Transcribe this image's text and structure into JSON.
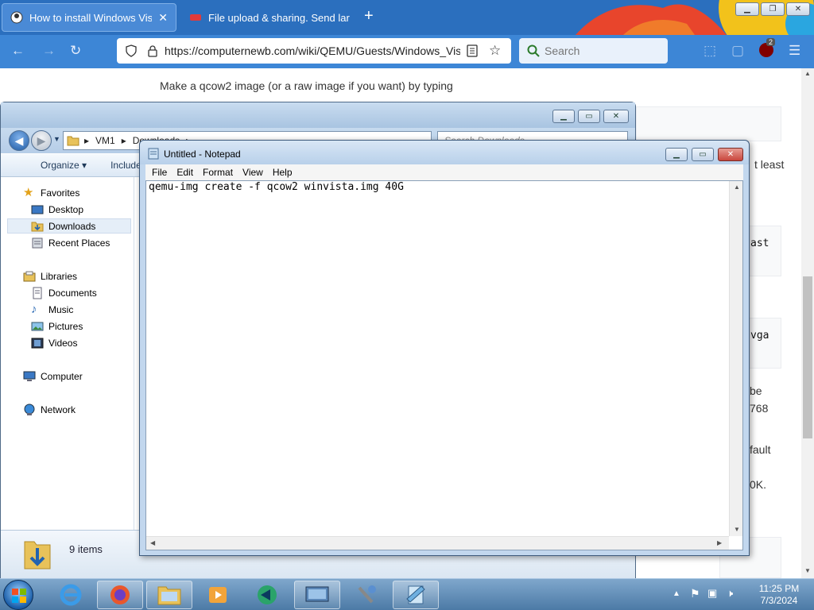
{
  "browser": {
    "tabs": [
      {
        "title": "How to install Windows Vista",
        "active": true
      },
      {
        "title": "File upload & sharing. Send lar",
        "active": false
      }
    ],
    "url": "https://computernewb.com/wiki/QEMU/Guests/Windows_Vis",
    "search_placeholder": "Search",
    "extension_badge": "2"
  },
  "webpage": {
    "intro_text": "Make a qcow2 image (or a raw image if you want) by typing",
    "right_fragments": [
      "t least",
      "ast",
      "vga",
      "be",
      "768",
      "fault",
      "0K."
    ]
  },
  "explorer": {
    "breadcrumb": [
      "VM1",
      "Downloads"
    ],
    "search_placeholder": "Search Downloads",
    "toolbar": {
      "organize": "Organize",
      "include": "Include in l"
    },
    "nav": {
      "favorites": "Favorites",
      "desktop": "Desktop",
      "downloads": "Downloads",
      "recent": "Recent Places",
      "libraries": "Libraries",
      "documents": "Documents",
      "music": "Music",
      "pictures": "Pictures",
      "videos": "Videos",
      "computer": "Computer",
      "network": "Network"
    },
    "item_count": "9 items"
  },
  "notepad": {
    "title": "Untitled - Notepad",
    "menu": [
      "File",
      "Edit",
      "Format",
      "View",
      "Help"
    ],
    "content": "qemu-img create -f qcow2 winvista.img 40G"
  },
  "taskbar": {
    "time": "11:25 PM",
    "date": "7/3/2024"
  },
  "colors": {
    "firefox_tabstrip": "#2b6fbe",
    "firefox_navbar": "#3d86d6",
    "win7_taskbar": "#4c7aa6",
    "notepad_close": "#c9463d"
  }
}
